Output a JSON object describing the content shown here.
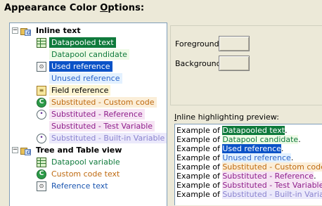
{
  "title": {
    "pre": "Appearance Color ",
    "mnemonic": "O",
    "post": "ptions:"
  },
  "colors": {
    "datapooled_bg": "#0f7a3c",
    "datapooled_fg": "#ffffff",
    "candidate_bg": "#eefae6",
    "candidate_fg": "#0f7a3c",
    "used_bg": "#0b52c7",
    "used_fg": "#ffffff",
    "unused_bg": "#e3f1ff",
    "unused_fg": "#2a63c9",
    "field_bg": "#fdf5d2",
    "field_fg": "#000000",
    "custom_bg": "#fbeed8",
    "custom_fg": "#bf6a10",
    "subref_bg": "#f6e4f4",
    "subref_fg": "#8e1d8a",
    "subtest_bg": "#f6e4f4",
    "subtest_fg": "#8e1d8a",
    "builtin_bg": "#ebe9fb",
    "builtin_fg": "#8a83cf",
    "dpvar_fg": "#0f7a3c",
    "customtext_fg": "#bf6a10",
    "reftext_fg": "#1a55b0"
  },
  "tree": {
    "inline_text": {
      "label": "Inline text",
      "items": [
        {
          "label": "Datapooled text",
          "icon": "datapool-grid-icon",
          "style": "datapooled"
        },
        {
          "label": "Datapool candidate",
          "icon": "",
          "style": "candidate"
        },
        {
          "label": "Used reference",
          "icon": "reference-icon",
          "style": "used"
        },
        {
          "label": "Unused reference",
          "icon": "",
          "style": "unused"
        },
        {
          "label": "Field reference",
          "icon": "field-reference-icon",
          "style": "field"
        },
        {
          "label": "Substituted - Custom code",
          "icon": "custom-code-icon",
          "style": "custom"
        },
        {
          "label": "Substituted - Reference",
          "icon": "substituted-reference-icon",
          "style": "subref"
        },
        {
          "label": "Substituted - Test Variable",
          "icon": "",
          "style": "subtest"
        },
        {
          "label": "Substituted - Built-in Variable",
          "icon": "builtin-variable-icon",
          "style": "builtin"
        }
      ]
    },
    "tree_table_view": {
      "label": "Tree and Table view",
      "items": [
        {
          "label": "Datapool variable",
          "icon": "datapool-grid-icon",
          "style": "dpvar"
        },
        {
          "label": "Custom code text",
          "icon": "custom-code-icon",
          "style": "customtext"
        },
        {
          "label": "Reference text",
          "icon": "reference-icon",
          "style": "reftext"
        }
      ]
    }
  },
  "foreground_label": "Foreground",
  "background_label": "Background",
  "preview_label": {
    "mnemonic": "I",
    "rest": "nline highlighting preview:"
  },
  "preview": {
    "prefix": "Example of ",
    "lines": [
      {
        "text": "Datapooled text",
        "style": "datapooled",
        "suffix": "."
      },
      {
        "text": "Datapool candidate",
        "style": "candidate",
        "suffix": "."
      },
      {
        "text": "Used reference",
        "style": "used",
        "suffix": "."
      },
      {
        "text": "Unused reference",
        "style": "unused",
        "suffix": "."
      },
      {
        "text": "Substituted - Custom code",
        "style": "custom",
        "suffix": "."
      },
      {
        "text": "Substituted - Reference",
        "style": "subref",
        "suffix": "."
      },
      {
        "text": "Substituted - Test Variable",
        "style": "subtest",
        "suffix": "."
      },
      {
        "text": "Substituted - Built-in Variable",
        "style": "builtin",
        "suffix": "."
      }
    ]
  }
}
